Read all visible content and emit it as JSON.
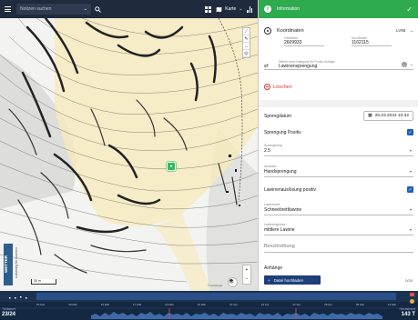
{
  "topbar": {
    "search_placeholder": "Notizen suchen",
    "map_label": "Karte"
  },
  "map": {
    "scale_label": "30 m",
    "logo_text": "WETTER",
    "logo_sub": "zuständig für Lawinen",
    "attribution": "© swisstopo"
  },
  "panel": {
    "header_title": "Information",
    "coordinates": {
      "label": "Koordinaten",
      "system": "LV95",
      "east_caption": "Ost/Meter",
      "east_value": "2609933",
      "north_caption": "Nord/Meter",
      "north_value": "1162115"
    },
    "vorlage": {
      "caption": "Wähle eine Kategorie für Punkt-Vorlage",
      "value": "Lawinensprengung"
    },
    "delete_label": "Löschen",
    "sprengdatum_label": "Sprengdatum",
    "sprengdatum_value": "26.03.2024 10:32",
    "sprengung_positiv_label": "Sprengung Positiv",
    "sprengerfolg_caption": "Sprengerfolg",
    "sprengerfolg_value": "2.5",
    "ausloeser_caption": "Auslöser",
    "ausloeser_value": "Handsprengung",
    "lawinenausloesung_label": "Lawinenauslösung positiv",
    "lawinenart_caption": "Lawinenart",
    "lawinenart_value": "Schneebrettlawine",
    "lawinengroesse_caption": "Lawinengrösse",
    "lawinengroesse_value": "mittlere Lawine",
    "beschreibung_placeholder": "Beschreibung",
    "anhaenge_label": "Anhänge",
    "upload_label": "Datei hochladen",
    "upload_count": "0/20"
  },
  "timeline": {
    "left_caption": "Tiefstwert",
    "left_value": "23/24",
    "right_caption": "Höchstwert",
    "right_value": "143 T",
    "right_time": "26.03.24 10:32",
    "ticks": [
      "25 Feb",
      "03 Mär",
      "10 Mär",
      "17 Mär",
      "24 Mär",
      "31 Mär",
      "07 Apr",
      "14 Apr",
      "21 Apr",
      "28 Apr",
      "05 Mai",
      "12 Mai"
    ]
  },
  "colors": {
    "topbar": "#1f2a3c",
    "panel_header": "#2eaa4f",
    "accent_blue": "#1e5fbf",
    "delete_red": "#dd3333",
    "timeline_bg": "#152842"
  }
}
